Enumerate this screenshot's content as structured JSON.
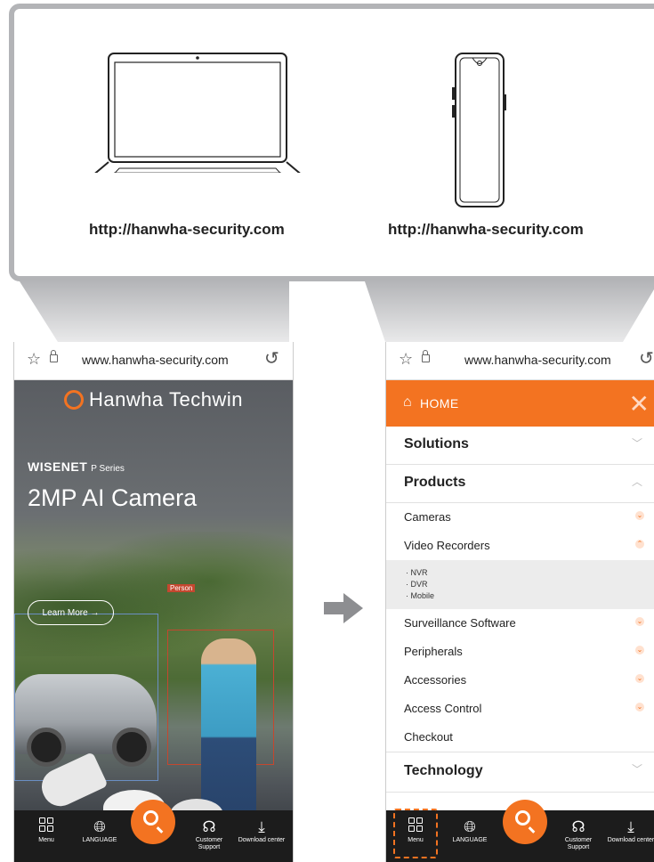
{
  "devices": {
    "laptop_url": "http://hanwha-security.com",
    "phone_url": "http://hanwha-security.com"
  },
  "browser": {
    "address": "www.hanwha-security.com"
  },
  "left_screen": {
    "brand": "Hanwha Techwin",
    "series_brand": "WISENET",
    "series_name": "P Series",
    "hero_title": "2MP AI Camera",
    "learn_more": "Learn More →",
    "person_tag": "Person"
  },
  "right_screen": {
    "home_label": "HOME",
    "categories": [
      {
        "label": "Solutions",
        "expanded": false
      },
      {
        "label": "Products",
        "expanded": true
      },
      {
        "label": "Technology",
        "expanded": false
      }
    ],
    "product_items": [
      {
        "label": "Cameras",
        "expanded": false
      },
      {
        "label": "Video Recorders",
        "expanded": true
      },
      {
        "label": "Surveillance Software",
        "expanded": false
      },
      {
        "label": "Peripherals",
        "expanded": false
      },
      {
        "label": "Accessories",
        "expanded": false
      },
      {
        "label": "Access Control",
        "expanded": false
      },
      {
        "label": "Checkout",
        "expanded": false
      }
    ],
    "recorder_sub": [
      "· NVR",
      "· DVR",
      "· Mobile"
    ]
  },
  "bottom_nav": {
    "menu": "Menu",
    "language": "LANGUAGE",
    "customer_support": "Customer Support",
    "download_center": "Download center"
  },
  "colors": {
    "accent": "#f37321",
    "nav_bg": "#1c1c1c",
    "panel_border": "#b3b4b7"
  }
}
